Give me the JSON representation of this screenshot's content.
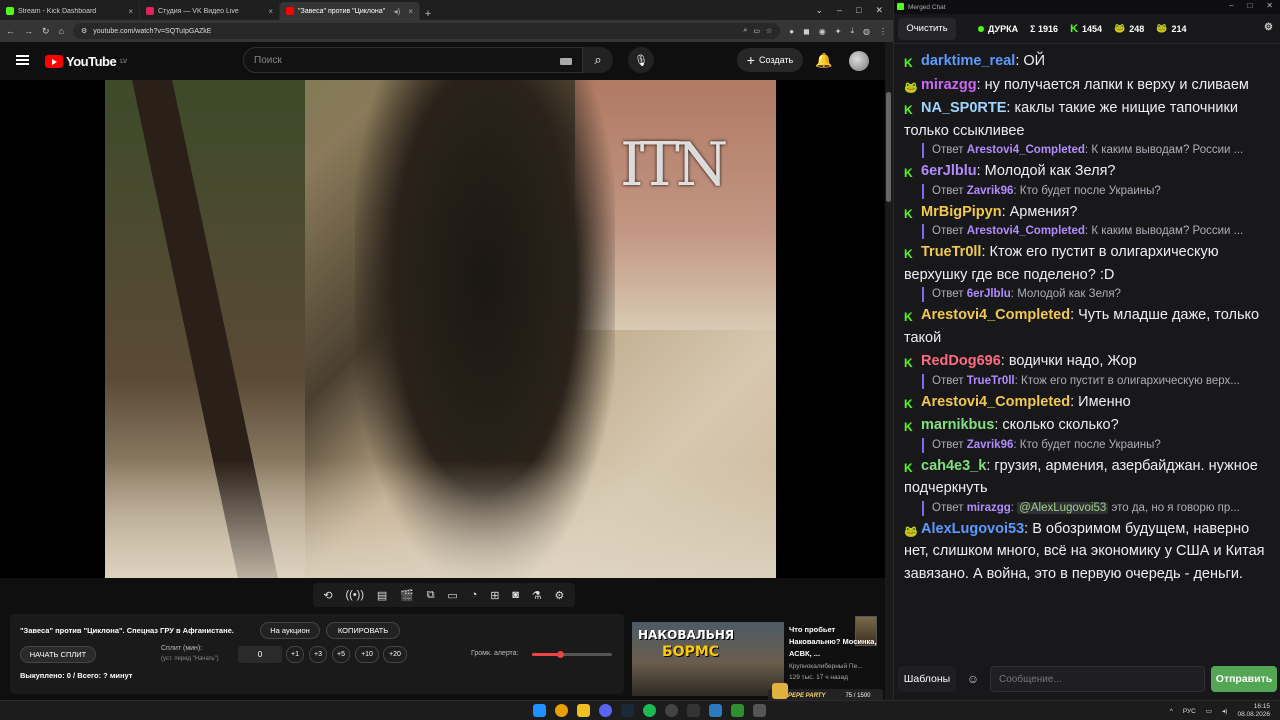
{
  "browser": {
    "tabs": [
      {
        "title": "Stream - Kick Dashboard",
        "color": "#53fc18"
      },
      {
        "title": "Студия — VK Видео Live",
        "color": "#e0245e"
      },
      {
        "title": "\"Завеса\" против \"Циклона\"",
        "color": "#ff0000"
      }
    ],
    "new_tab": "+",
    "url": "youtube.com/watch?v=SQTuIpGAZkE"
  },
  "youtube": {
    "logo": "YouTube",
    "region": "LV",
    "search_placeholder": "Поиск",
    "create_label": "Создать"
  },
  "video": {
    "watermark": "ITN"
  },
  "panel": {
    "title": "\"Завеса\" против \"Циклона\". Спецназ ГРУ в Афганистане.",
    "auction_button": "На аукцион",
    "copy_button": "КОПИРОВАТЬ",
    "start_split_button": "НАЧАТЬ СПЛИТ",
    "split_label": "Сплит (мин):",
    "split_hint": "(уст. перед \"Начать\")",
    "split_value": "0",
    "increments": [
      "+1",
      "+3",
      "+5",
      "+10",
      "+20"
    ],
    "volume_label": "Громк. алерта:",
    "volume_level": 0.35,
    "bought_text": "Выкуплено: 0 / Всего: ? минут"
  },
  "recommended": {
    "thumb_line1": "НАКОВАЛЬНЯ",
    "thumb_line2": "БОРМС",
    "title": "Что пробьет Наковальню? Мосинка, АСВК, ...",
    "channel": "Крупнокалиберный Пе...",
    "meta": "129 тыс.   17 ч назад"
  },
  "party": {
    "name": "PEPE PARTY",
    "count": "75 / 1500"
  },
  "chat": {
    "window_title": "Merged Chat",
    "clear_button": "Очистить",
    "status_name": "ДУРКА",
    "total": "Σ 1916",
    "kick_count": "1454",
    "vk_count": "248",
    "other_count": "214",
    "templates_button": "Шаблоны",
    "input_placeholder": "Сообщение...",
    "send_button": "Отправить",
    "reply_prefix": "Ответ"
  },
  "messages": [
    {
      "badge": "K",
      "user": "darktime_real",
      "color": "#5b9bff",
      "text": "ОЙ"
    },
    {
      "badge": "pepe",
      "user": "mirazgg",
      "color": "#c86af2",
      "text": "ну получается лапки к верху и сливаем"
    },
    {
      "badge": "K",
      "user": "NA_SP0RTE",
      "color": "#9fd6ff",
      "text": "каклы такие же нищие тапочники только ссыкливее",
      "reply_to": {
        "user": "Arestovi4_Completed",
        "ucolor": "#b28cff",
        "text": "К каким выводам? России ..."
      }
    },
    {
      "badge": "K",
      "user": "6erJlblu",
      "color": "#b28cff",
      "text": "Молодой как Зеля?",
      "reply_to": {
        "user": "Zavrik96",
        "ucolor": "#b28cff",
        "text": "Кто будет после Украины?"
      }
    },
    {
      "badge": "K",
      "user": "MrBigPipyn",
      "color": "#f2c94c",
      "text": "Армения?",
      "reply_to": {
        "user": "Arestovi4_Completed",
        "ucolor": "#b28cff",
        "text": "К каким выводам? России ..."
      }
    },
    {
      "badge": "K",
      "user": "TrueTr0ll",
      "color": "#f2c94c",
      "text": "Ктож его пустит в олигархическую верхушку где все поделено? :D",
      "reply_to": {
        "user": "6erJlblu",
        "ucolor": "#b28cff",
        "text": "Молодой как Зеля?"
      }
    },
    {
      "badge": "K",
      "user": "Arestovi4_Completed",
      "color": "#f2c94c",
      "text": "Чуть младше даже, только такой"
    },
    {
      "badge": "K",
      "user": "RedDog696",
      "color": "#ff6b81",
      "text": "водички надо, Жор",
      "reply_to": {
        "user": "TrueTr0ll",
        "ucolor": "#b28cff",
        "text": "Ктож его пустит в олигархическую верх..."
      }
    },
    {
      "badge": "K",
      "user": "Arestovi4_Completed",
      "color": "#f2c94c",
      "text": "Именно"
    },
    {
      "badge": "K",
      "user": "marnikbus",
      "color": "#7ee07e",
      "text": "сколько сколько?",
      "reply_to": {
        "user": "Zavrik96",
        "ucolor": "#b28cff",
        "text": "Кто будет после Украины?"
      }
    },
    {
      "badge": "K",
      "user": "cah4e3_k",
      "color": "#7ee07e",
      "text": "грузия, армения, азербайджан. нужное подчеркнуть",
      "reply_to": {
        "user": "mirazgg",
        "ucolor": "#b28cff",
        "mention": "@AlexLugovoi53",
        "text": "это да, но я говорю пр..."
      }
    },
    {
      "badge": "pepe",
      "user": "AlexLugovoi53",
      "color": "#5b9bff",
      "text": "В обозримом будущем, наверно нет, слишком много, всё на экономику у США и Китая завязано. А война, это в первую очередь - деньги."
    }
  ],
  "taskbar": {
    "lang": "РУС",
    "time": "16:15",
    "date": "08.08.2026"
  }
}
